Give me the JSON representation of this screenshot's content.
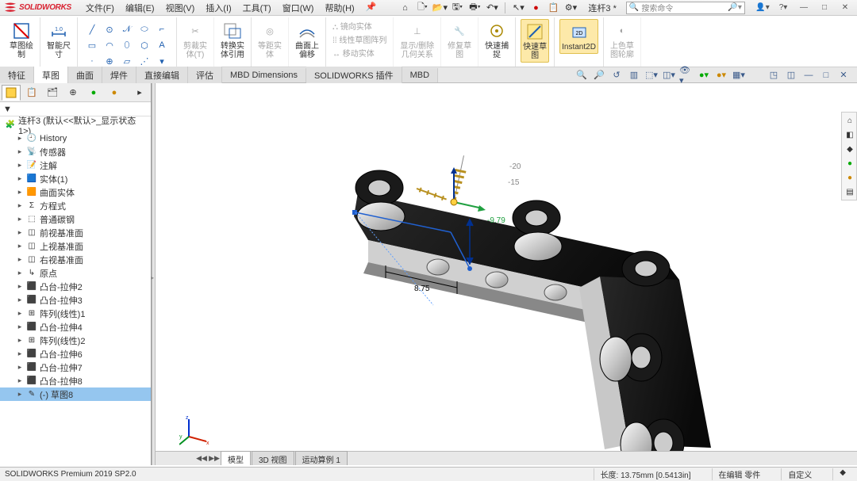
{
  "app": {
    "name": "SOLIDWORKS",
    "doc_title": "连杆3 *"
  },
  "menu": {
    "items": [
      "文件(F)",
      "编辑(E)",
      "视图(V)",
      "插入(I)",
      "工具(T)",
      "窗口(W)",
      "帮助(H)"
    ]
  },
  "search": {
    "placeholder": "搜索命令"
  },
  "ribbon": {
    "sketch_exit": "草图绘\n制",
    "smart_dim": "智能尺\n寸",
    "trim": "剪裁实\n体(T)",
    "convert": "转换实\n体引用",
    "offset_entities": "等距实\n体",
    "offset_surface": "曲面上\n偏移",
    "mirror": "镜向实体",
    "linear_pattern": "线性草图阵列",
    "move": "移动实体",
    "display_delete": "显示/删除\n几何关系",
    "repair": "修复草\n图",
    "quick_snap": "快速捕\n捉",
    "rapid_sketch": "快速草\n图",
    "instant2d": "Instant2D",
    "shaded_contour": "上色草\n图轮廓"
  },
  "tabs": {
    "items": [
      "特征",
      "草图",
      "曲面",
      "焊件",
      "直接编辑",
      "评估",
      "MBD Dimensions",
      "SOLIDWORKS 插件",
      "MBD"
    ],
    "active": 1
  },
  "tree": {
    "root": "连杆3 (默认<<默认>_显示状态 1>)",
    "items": [
      {
        "icon": "history",
        "label": "History"
      },
      {
        "icon": "sensor",
        "label": "传感器"
      },
      {
        "icon": "annotation",
        "label": "注解"
      },
      {
        "icon": "solid",
        "label": "实体(1)"
      },
      {
        "icon": "surface",
        "label": "曲面实体"
      },
      {
        "icon": "equation",
        "label": "方程式"
      },
      {
        "icon": "material",
        "label": "普通碳钢"
      },
      {
        "icon": "plane",
        "label": "前视基准面"
      },
      {
        "icon": "plane",
        "label": "上视基准面"
      },
      {
        "icon": "plane",
        "label": "右视基准面"
      },
      {
        "icon": "origin",
        "label": "原点"
      },
      {
        "icon": "extrude",
        "label": "凸台-拉伸2"
      },
      {
        "icon": "extrude",
        "label": "凸台-拉伸3"
      },
      {
        "icon": "pattern",
        "label": "阵列(线性)1"
      },
      {
        "icon": "extrude",
        "label": "凸台-拉伸4"
      },
      {
        "icon": "pattern",
        "label": "阵列(线性)2"
      },
      {
        "icon": "extrude",
        "label": "凸台-拉伸6"
      },
      {
        "icon": "extrude",
        "label": "凸台-拉伸7"
      },
      {
        "icon": "extrude",
        "label": "凸台-拉伸8"
      },
      {
        "icon": "sketch",
        "label": "(-) 草图8",
        "selected": true
      }
    ]
  },
  "viewport": {
    "dim_horizontal": "8.75",
    "dim_offset": "-9.79",
    "dim_rot1": "-20",
    "dim_rot2": "-15"
  },
  "bottom_tabs": {
    "items": [
      "模型",
      "3D 视图",
      "运动算例 1"
    ],
    "active": 0
  },
  "status": {
    "product": "SOLIDWORKS Premium 2019 SP2.0",
    "length": "长度: 13.75mm [0.5413in]",
    "editing": "在编辑 零件",
    "custom": "自定义"
  }
}
